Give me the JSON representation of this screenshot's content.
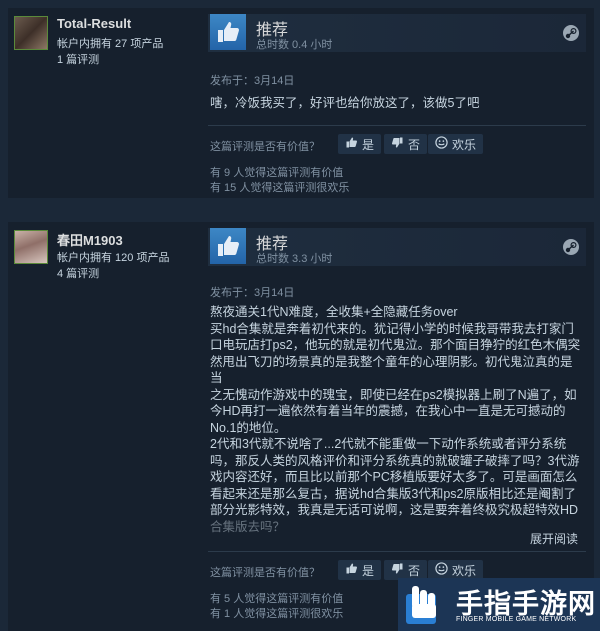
{
  "reviews": [
    {
      "author": {
        "name": "Total-Result",
        "products": "帐户内拥有 27 项产品",
        "review_count": "1 篇评测"
      },
      "recommendation": "推荐",
      "hours": "总时数 0.4 小时",
      "posted": "发布于：3月14日",
      "text_lines": [
        "嗐，冷饭我买了，好评也给你放这了，该做5了吧"
      ],
      "helpful_question": "这篇评测是否有价值？",
      "buttons": {
        "yes": "是",
        "no": "否",
        "funny": "欢乐"
      },
      "helpful_count": "有 9 人觉得这篇评测有价值",
      "funny_count": "有 15 人觉得这篇评测很欢乐"
    },
    {
      "author": {
        "name": "春田M1903",
        "products": "帐户内拥有 120 项产品",
        "review_count": "4 篇评测"
      },
      "recommendation": "推荐",
      "hours": "总时数 3.3 小时",
      "posted": "发布于：3月14日",
      "text_lines": [
        "熬夜通关1代N难度，全收集+全隐藏任务over",
        "买hd合集就是奔着初代来的。犹记得小学的时候我哥带我去打家门",
        "口电玩店打ps2，他玩的就是初代鬼泣。那个面目狰狞的红色木偶突",
        "然甩出飞刀的场景真的是我整个童年的心理阴影。初代鬼泣真的是当",
        "之无愧动作游戏中的瑰宝，即使已经在ps2模拟器上刷了N遍了，如",
        "今HD再打一遍依然有着当年的震撼，在我心中一直是无可撼动的",
        "No.1的地位。",
        "2代和3代就不说啥了...2代就不能重做一下动作系统或者评分系统",
        "吗，那反人类的风格评价和评分系统真的就破罐子破摔了吗？3代游",
        "戏内容还好，而且比以前那个PC移植版要好太多了。可是画面怎么",
        "看起来还是那么复古，据说hd合集版3代和ps2原版相比还是阉割了",
        "部分光影特效，我真是无话可说啊，这是要奔着终极究极超特效HD",
        "合集版去吗？"
      ],
      "expand": "展开阅读",
      "helpful_question": "这篇评测是否有价值？",
      "buttons": {
        "yes": "是",
        "no": "否",
        "funny": "欢乐"
      },
      "helpful_count": "有 5 人觉得这篇评测有价值",
      "funny_count": "有 1 人觉得这篇评测很欢乐"
    }
  ],
  "watermark": {
    "name": "手指手游网",
    "sub": "FINGER MOBILE GAME NETWORK"
  },
  "colors": {
    "thumb_blue": "#2f74b8",
    "background": "#1b2838",
    "watermark_bg": "#1c3555"
  }
}
